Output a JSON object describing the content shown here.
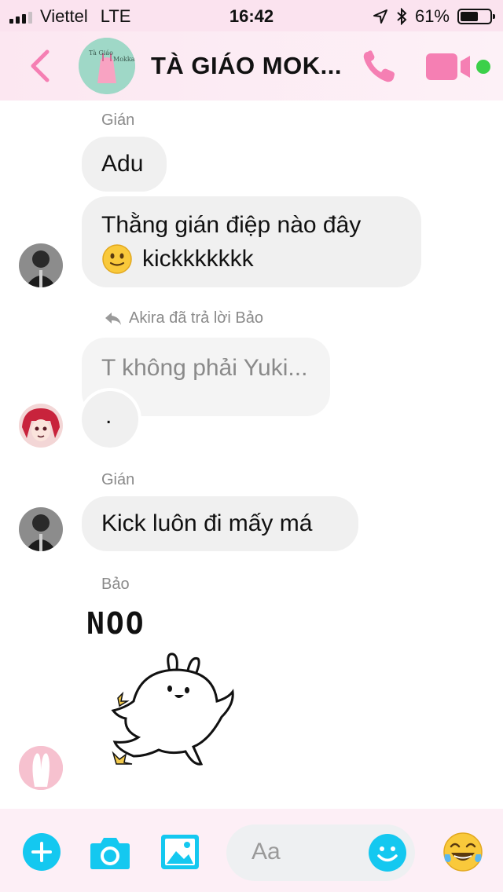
{
  "status_bar": {
    "carrier": "Viettel",
    "network": "LTE",
    "time": "16:42",
    "battery": "61%",
    "battery_level": 0.61
  },
  "header": {
    "title": "TÀ GIÁO MOK...",
    "avatar_text": "Tà Giáo\nMokka"
  },
  "messages": [
    {
      "sender": "Gián",
      "text": "Adu"
    },
    {
      "text_line1": "Thằng gián điệp nào đây",
      "text_line2": "kickkkkkkk"
    },
    {
      "reply_note": "Akira đã trả lời Bảo",
      "quoted": "T không phải Yuki...",
      "text": "."
    },
    {
      "sender": "Gián",
      "text": "Kick luôn đi mấy má"
    },
    {
      "sender": "Bảo",
      "sticker_text": "NOO"
    }
  ],
  "composer": {
    "placeholder": "Aa"
  },
  "colors": {
    "accent_pink": "#f57fb3",
    "accent_cyan": "#14c8f0",
    "online_green": "#3cd04a"
  },
  "icons": [
    "back-icon",
    "phone-icon",
    "video-icon",
    "plus-icon",
    "camera-icon",
    "image-icon",
    "smile-icon",
    "laugh-emoji-icon",
    "reply-icon",
    "slight-smile-emoji"
  ]
}
